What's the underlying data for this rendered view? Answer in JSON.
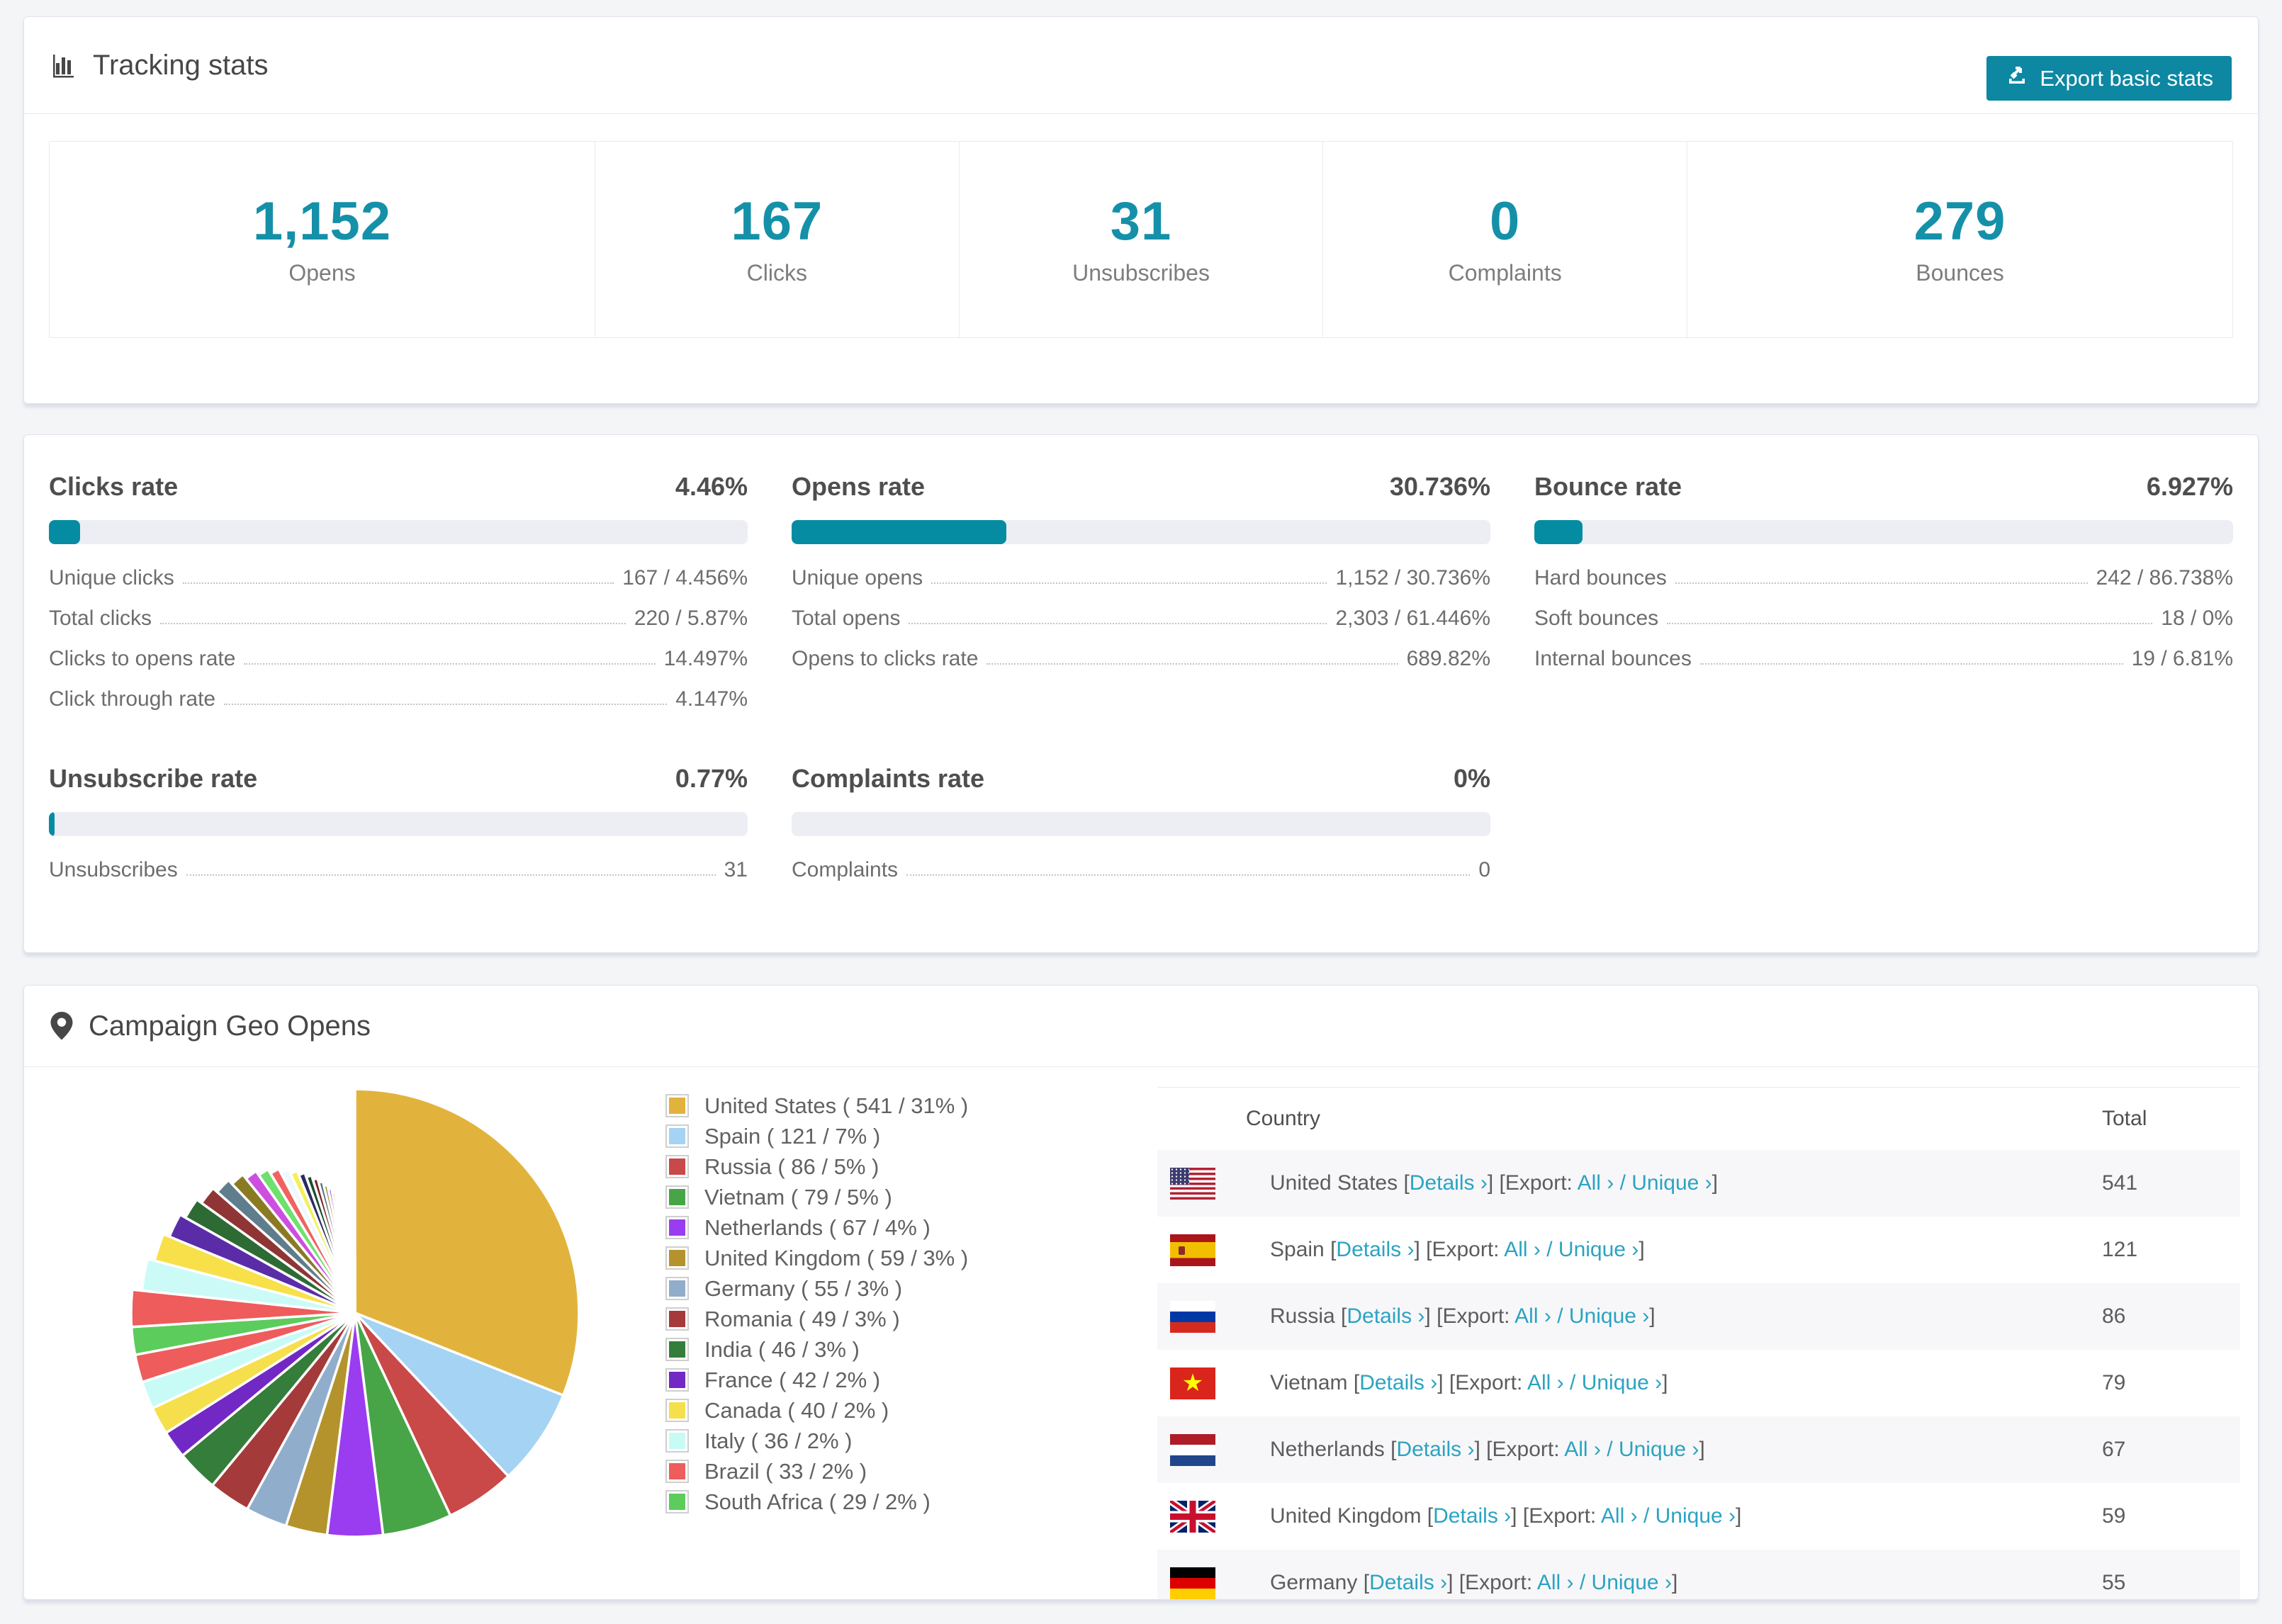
{
  "tracking": {
    "title": "Tracking stats",
    "export_button": "Export basic stats",
    "stats": [
      {
        "value": "1,152",
        "label": "Opens"
      },
      {
        "value": "167",
        "label": "Clicks"
      },
      {
        "value": "31",
        "label": "Unsubscribes"
      },
      {
        "value": "0",
        "label": "Complaints"
      },
      {
        "value": "279",
        "label": "Bounces"
      }
    ]
  },
  "rates": [
    {
      "title": "Clicks rate",
      "pct_label": "4.46%",
      "pct": 4.46,
      "rows": [
        {
          "label": "Unique clicks",
          "value": "167 / 4.456%"
        },
        {
          "label": "Total clicks",
          "value": "220 / 5.87%"
        },
        {
          "label": "Clicks to opens rate",
          "value": "14.497%"
        },
        {
          "label": "Click through rate",
          "value": "4.147%"
        }
      ]
    },
    {
      "title": "Opens rate",
      "pct_label": "30.736%",
      "pct": 30.736,
      "rows": [
        {
          "label": "Unique opens",
          "value": "1,152 / 30.736%"
        },
        {
          "label": "Total opens",
          "value": "2,303 / 61.446%"
        },
        {
          "label": "Opens to clicks rate",
          "value": "689.82%"
        }
      ]
    },
    {
      "title": "Bounce rate",
      "pct_label": "6.927%",
      "pct": 6.927,
      "rows": [
        {
          "label": "Hard bounces",
          "value": "242 / 86.738%"
        },
        {
          "label": "Soft bounces",
          "value": "18 / 0%"
        },
        {
          "label": "Internal bounces",
          "value": "19 / 6.81%"
        }
      ]
    },
    {
      "title": "Unsubscribe rate",
      "pct_label": "0.77%",
      "pct": 0.77,
      "rows": [
        {
          "label": "Unsubscribes",
          "value": "31"
        }
      ]
    },
    {
      "title": "Complaints rate",
      "pct_label": "0%",
      "pct": 0,
      "rows": [
        {
          "label": "Complaints",
          "value": "0"
        }
      ]
    }
  ],
  "geo": {
    "title": "Campaign Geo Opens",
    "table": {
      "headers": {
        "country": "Country",
        "total": "Total"
      },
      "links": {
        "details": "Details ›",
        "export_prefix": "[Export:",
        "all": "All ›",
        "slash": "/",
        "unique": "Unique ›"
      },
      "rows": [
        {
          "country": "United States",
          "flag": "us",
          "total": "541"
        },
        {
          "country": "Spain",
          "flag": "es",
          "total": "121"
        },
        {
          "country": "Russia",
          "flag": "ru",
          "total": "86"
        },
        {
          "country": "Vietnam",
          "flag": "vn",
          "total": "79"
        },
        {
          "country": "Netherlands",
          "flag": "nl",
          "total": "67"
        },
        {
          "country": "United Kingdom",
          "flag": "gb",
          "total": "59"
        },
        {
          "country": "Germany",
          "flag": "de",
          "total": "55"
        }
      ]
    }
  },
  "chart_data": {
    "type": "pie",
    "title": "Campaign Geo Opens",
    "legend_position": "right",
    "start_angle_deg": 0,
    "slices": [
      {
        "label": "United States",
        "count": "541",
        "pct": 31,
        "color": "#e2b33c"
      },
      {
        "label": "Spain",
        "count": "121",
        "pct": 7,
        "color": "#a5d3f3"
      },
      {
        "label": "Russia",
        "count": "86",
        "pct": 5,
        "color": "#c94848"
      },
      {
        "label": "Vietnam",
        "count": "79",
        "pct": 5,
        "color": "#47a547"
      },
      {
        "label": "Netherlands",
        "count": "67",
        "pct": 4,
        "color": "#9a3cf0"
      },
      {
        "label": "United Kingdom",
        "count": "59",
        "pct": 3,
        "color": "#b4932c"
      },
      {
        "label": "Germany",
        "count": "55",
        "pct": 3,
        "color": "#90aecb"
      },
      {
        "label": "Romania",
        "count": "49",
        "pct": 3,
        "color": "#a53a3a"
      },
      {
        "label": "India",
        "count": "46",
        "pct": 3,
        "color": "#357d3a"
      },
      {
        "label": "France",
        "count": "42",
        "pct": 2,
        "color": "#7228c4"
      },
      {
        "label": "Canada",
        "count": "40",
        "pct": 2,
        "color": "#f6df4c"
      },
      {
        "label": "Italy",
        "count": "36",
        "pct": 2,
        "color": "#c8fbf6"
      },
      {
        "label": "Brazil",
        "count": "33",
        "pct": 2,
        "color": "#ee5c5c"
      },
      {
        "label": "South Africa",
        "count": "29",
        "pct": 2,
        "color": "#5ccc5c"
      }
    ],
    "other_unlabeled": {
      "total_pct": 26,
      "slice_count": 36,
      "decay": 0.9,
      "palette": [
        "#ee5c5c",
        "#ccfbf7",
        "#f7e04a",
        "#5b2ca8",
        "#2e6b34",
        "#8f3535",
        "#5f7d8c",
        "#8a7a24",
        "#cc4fe0",
        "#6ee06e",
        "#f06262",
        "#eef8ff",
        "#f5ef5a",
        "#2a2a66",
        "#1d4d2a",
        "#7a2626",
        "#4a6a7a",
        "#9a8a2a",
        "#8a2ce0",
        "#d4a93a",
        "#a8d4f0",
        "#e05050",
        "#3aa04a",
        "#b03ae0",
        "#ff7ad0",
        "#e8b84a",
        "#c8e8f8",
        "#d05050",
        "#50b050",
        "#9050d0"
      ]
    }
  }
}
